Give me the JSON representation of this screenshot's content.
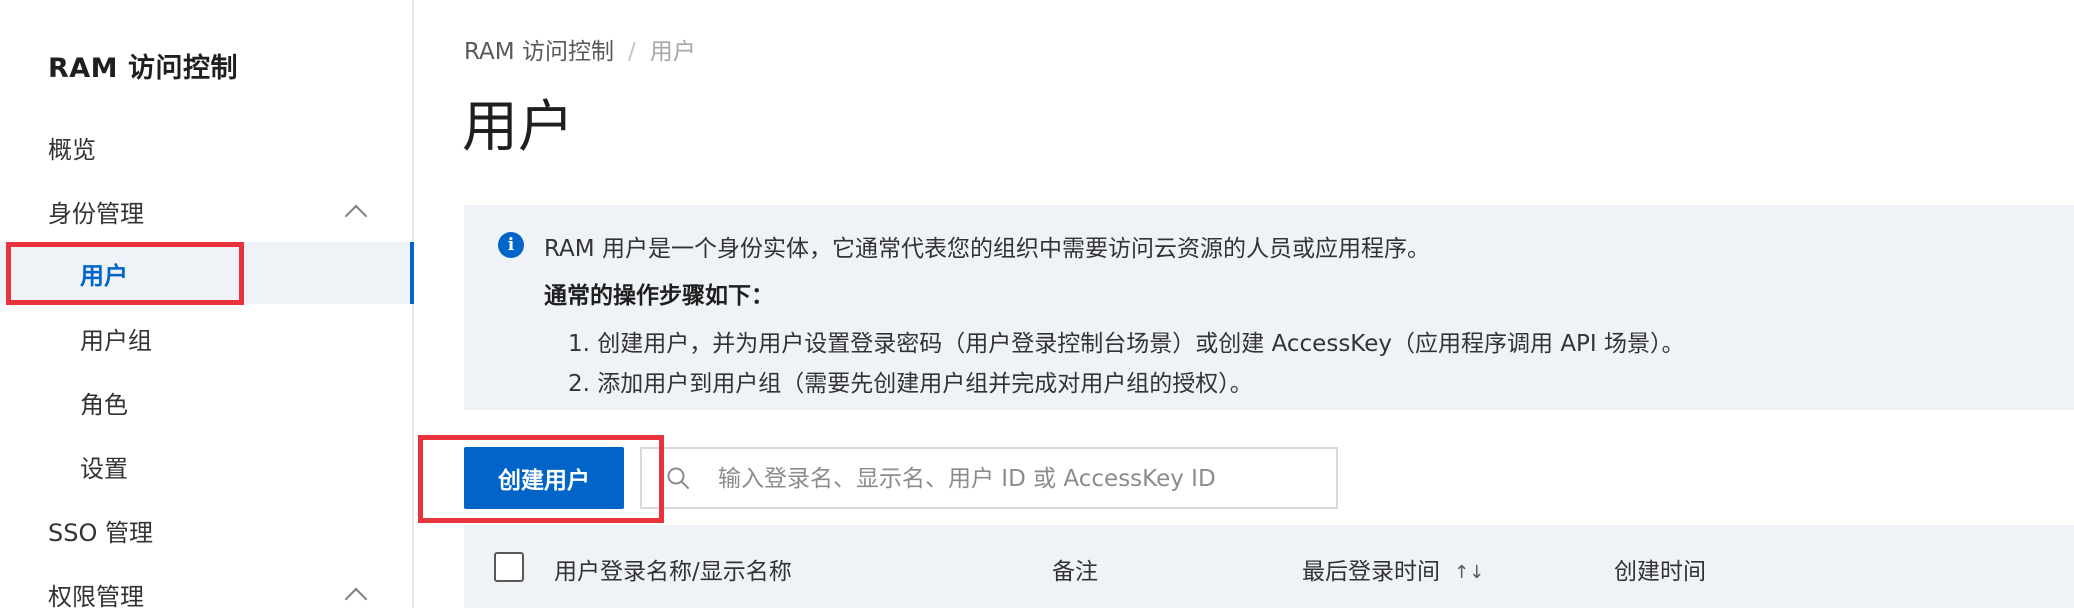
{
  "sidebar": {
    "title": "RAM 访问控制",
    "items": [
      {
        "label": "概览"
      },
      {
        "label": "身份管理"
      },
      {
        "label": "用户"
      },
      {
        "label": "用户组"
      },
      {
        "label": "角色"
      },
      {
        "label": "设置"
      },
      {
        "label": "SSO 管理"
      },
      {
        "label": "权限管理"
      }
    ]
  },
  "breadcrumb": {
    "root": "RAM 访问控制",
    "separator": "/",
    "current": "用户"
  },
  "page": {
    "title": "用户"
  },
  "info": {
    "icon": "info-icon",
    "description": "RAM 用户是一个身份实体，它通常代表您的组织中需要访问云资源的人员或应用程序。",
    "steps_title": "通常的操作步骤如下：",
    "step1": "1. 创建用户，并为用户设置登录密码（用户登录控制台场景）或创建 AccessKey（应用程序调用 API 场景）。",
    "step2": "2. 添加用户到用户组（需要先创建用户组并完成对用户组的授权）。"
  },
  "toolbar": {
    "create_label": "创建用户",
    "search_placeholder": "输入登录名、显示名、用户 ID 或 AccessKey ID"
  },
  "table": {
    "columns": [
      "用户登录名称/显示名称",
      "备注",
      "最后登录时间",
      "创建时间"
    ],
    "sort_icon": "↑↓"
  },
  "colors": {
    "accent": "#0064c8",
    "panel_background": "#eff3f8",
    "highlight_border": "#e8323c"
  }
}
